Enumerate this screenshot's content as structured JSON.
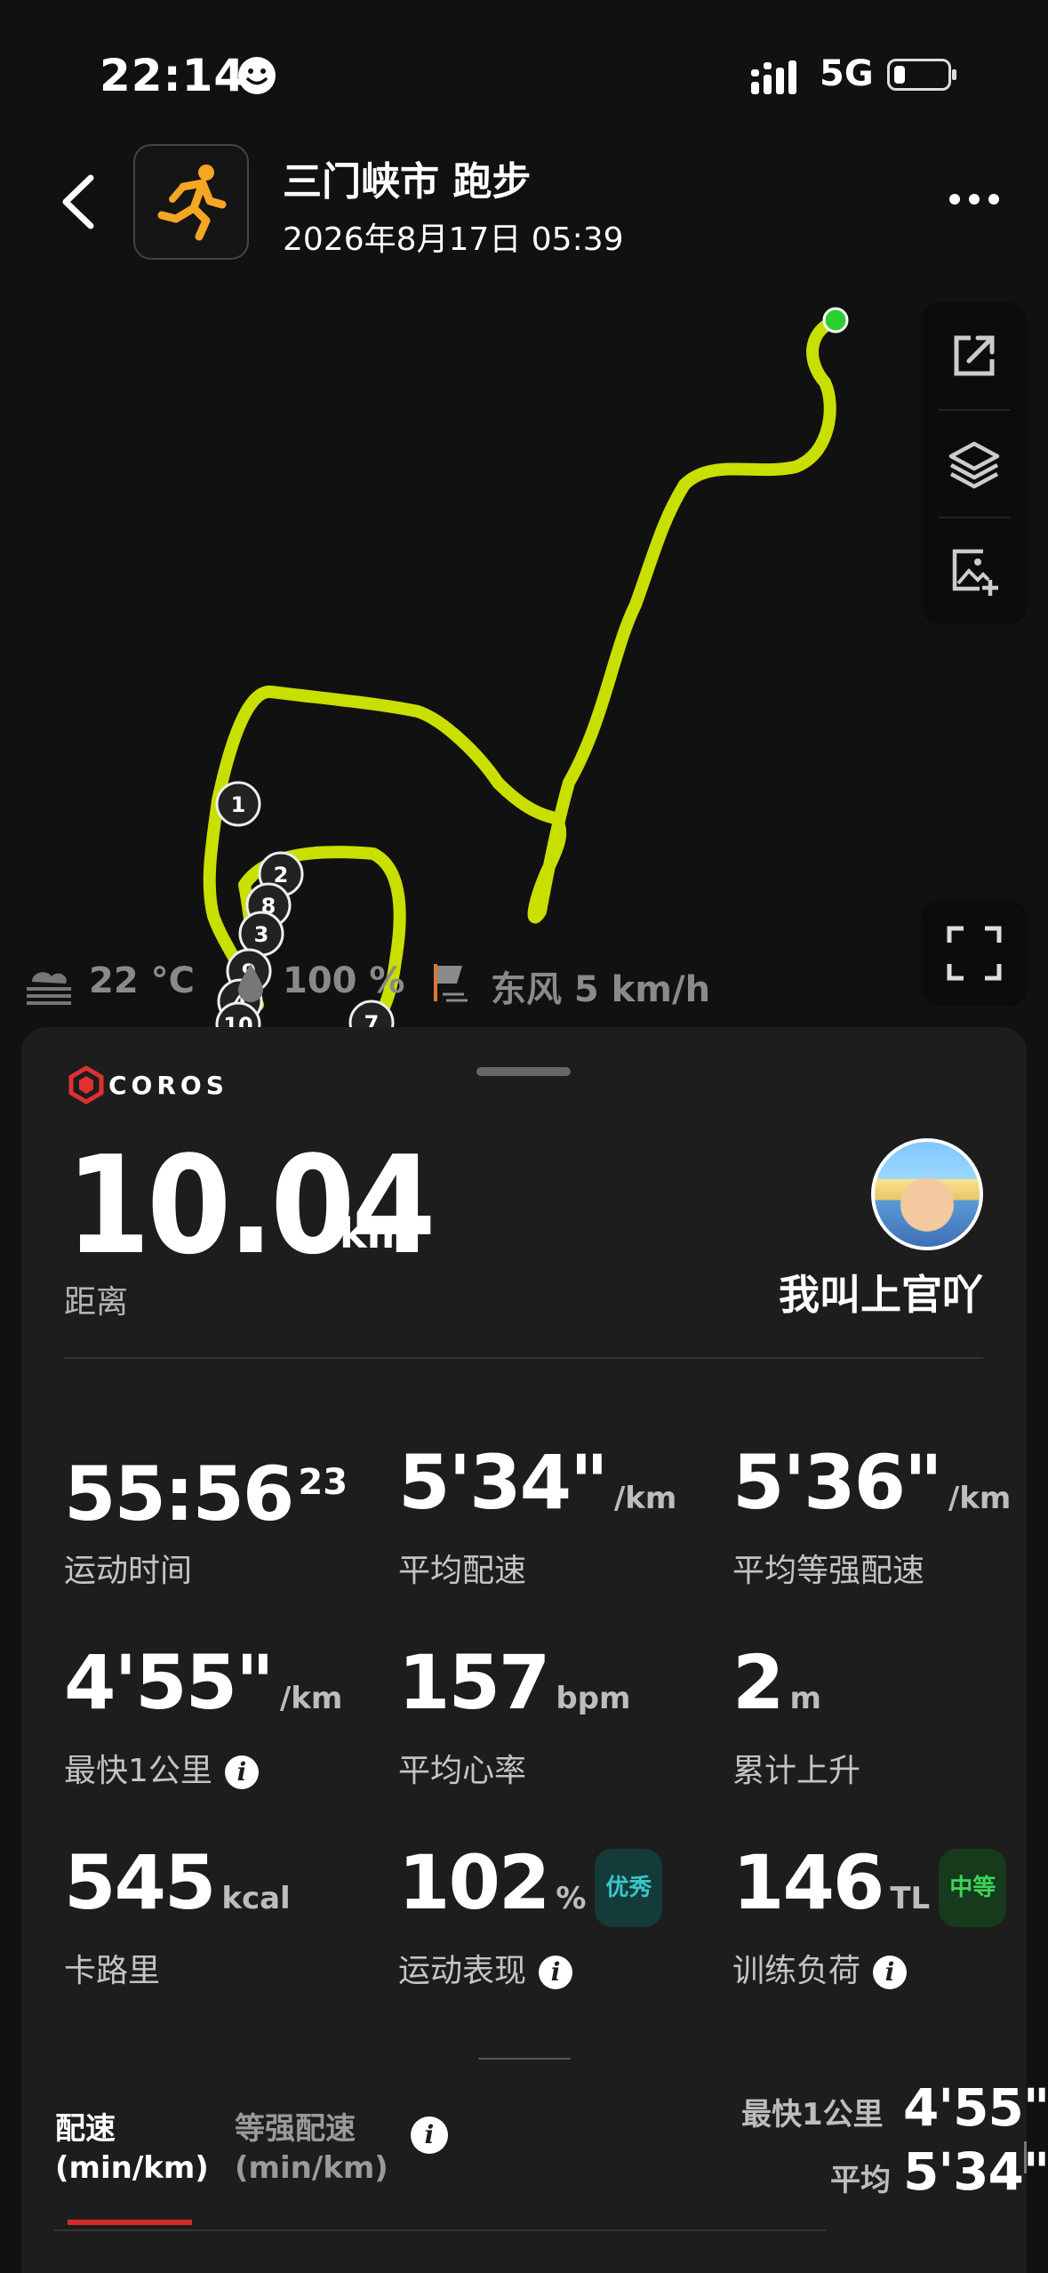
{
  "status_bar": {
    "time": "22:14",
    "network": "5G",
    "battery_level": 0.2
  },
  "header": {
    "back_icon": "chevron-left-icon",
    "activity_icon": "running-icon",
    "title": "三门峡市 跑步",
    "datetime": "2026年8月17日 05:39",
    "more_icon": "more-horizontal-icon"
  },
  "map": {
    "route_color": "#c8df00",
    "start_color": "#2bd030",
    "km_markers": [
      "1",
      "2",
      "8",
      "3",
      "9",
      "4",
      "10",
      "7"
    ],
    "tools": [
      "share-icon",
      "layers-icon",
      "add-image-icon"
    ],
    "fullscreen_icon": "fullscreen-icon"
  },
  "weather": {
    "temperature": "22 °C",
    "humidity": "100 %",
    "wind": "东风 5 km/h"
  },
  "summary": {
    "brand": "COROS",
    "distance": "10.04",
    "distance_unit": "km",
    "distance_label": "距离",
    "username": "我叫上官吖"
  },
  "metrics": [
    {
      "value": "55:56",
      "sup": "23",
      "unit": "",
      "label": "运动时间"
    },
    {
      "value": "5'34\"",
      "unit": "/km",
      "label": "平均配速"
    },
    {
      "value": "5'36\"",
      "unit": "/km",
      "label": "平均等强配速"
    },
    {
      "value": "4'55\"",
      "unit": "/km",
      "label": "最快1公里",
      "info": "i"
    },
    {
      "value": "157",
      "unit": "bpm",
      "label": "平均心率"
    },
    {
      "value": "2",
      "unit": "m",
      "label": "累计上升"
    },
    {
      "value": "545",
      "unit": "kcal",
      "label": "卡路里"
    },
    {
      "value": "102",
      "unit": "%",
      "badge": "优秀",
      "label": "运动表现",
      "info": "i"
    },
    {
      "value": "146",
      "unit": "TL",
      "badge": "中等",
      "label": "训练负荷",
      "info": "i"
    }
  ],
  "badge_colors": {
    "excellent_bg": "#143a3a",
    "excellent_fg": "#39c6c6",
    "medium_bg": "#163a1c",
    "medium_fg": "#3bd45a"
  },
  "chart_tabs": {
    "tab1_line1": "配速",
    "tab1_line2": "(min/km)",
    "tab2_line1": "等强配速",
    "tab2_line2": "(min/km)",
    "info": "i",
    "fastest_label": "最快1公里",
    "fastest_value": "4'55\"",
    "avg_label": "平均",
    "avg_value": "5'34\""
  }
}
